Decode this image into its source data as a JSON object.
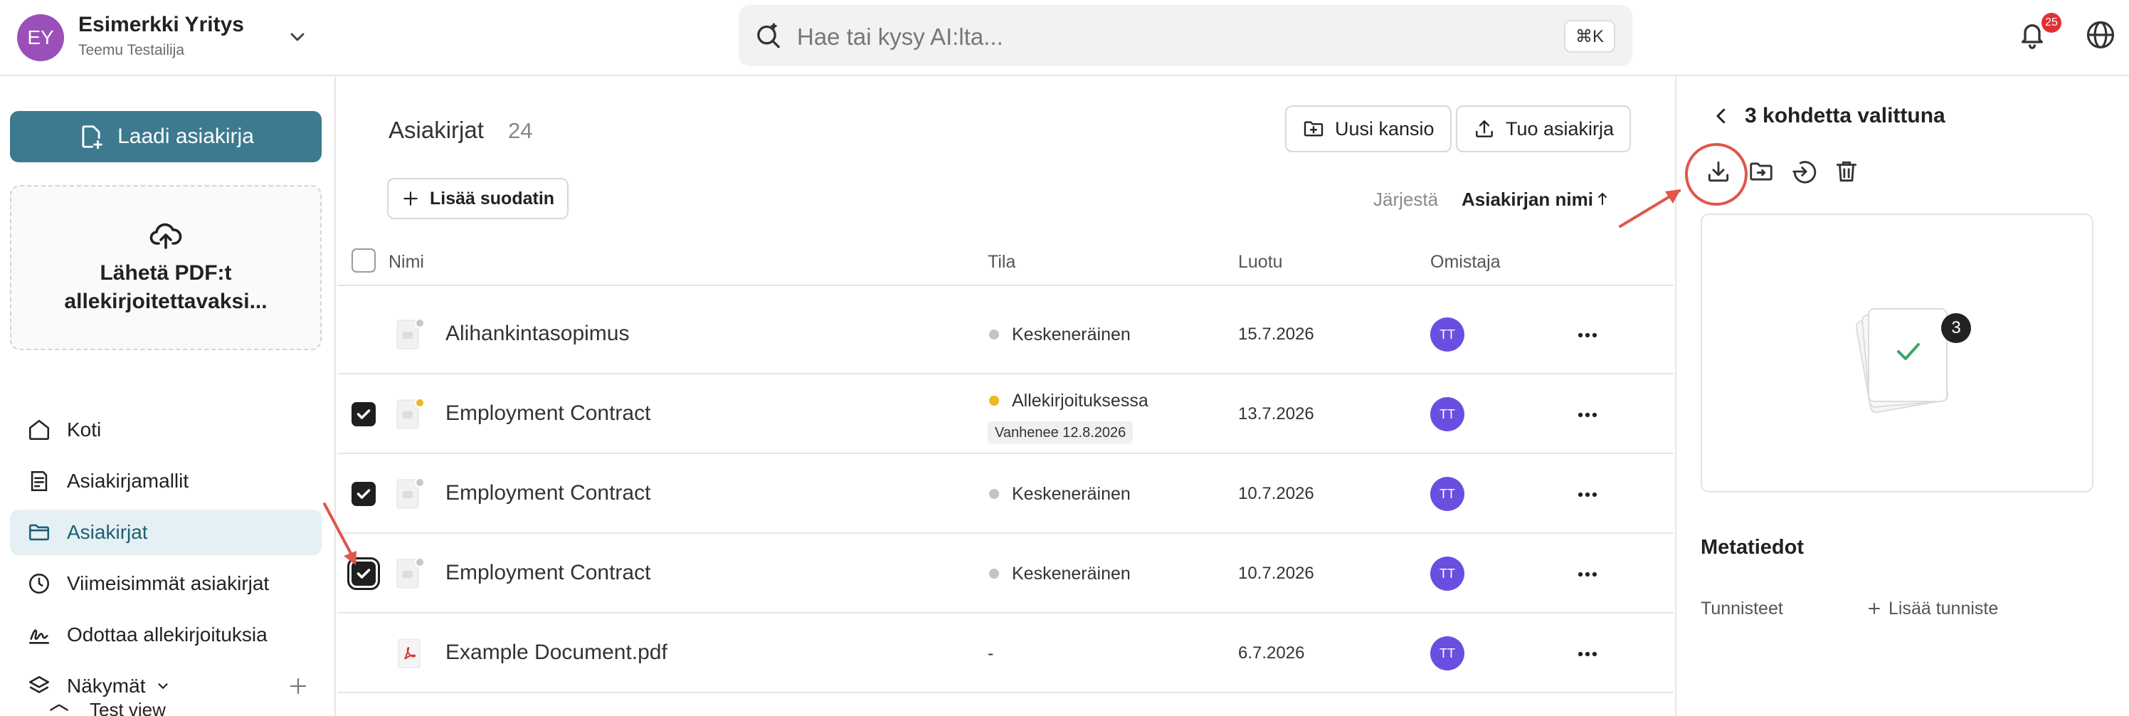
{
  "topbar": {
    "org_initials": "EY",
    "org_name": "Esimerkki Yritys",
    "user_name": "Teemu Testailija",
    "search_placeholder": "Hae tai kysy AI:lta...",
    "search_shortcut": "⌘K",
    "notification_count": "25"
  },
  "sidebar": {
    "create_button": "Laadi asiakirja",
    "upload_text": "Lähetä PDF:t allekirjoitettavaksi...",
    "items": [
      {
        "label": "Koti",
        "icon": "home-icon"
      },
      {
        "label": "Asiakirjamallit",
        "icon": "template-icon"
      },
      {
        "label": "Asiakirjat",
        "icon": "folder-icon",
        "active": true
      },
      {
        "label": "Viimeisimmät asiakirjat",
        "icon": "clock-icon"
      },
      {
        "label": "Odottaa allekirjoituksia",
        "icon": "signature-icon"
      },
      {
        "label": "Näkymät",
        "icon": "layers-icon"
      }
    ],
    "sub_item": "Test view"
  },
  "main": {
    "title": "Asiakirjat",
    "count": "24",
    "new_folder_button": "Uusi kansio",
    "import_button": "Tuo asiakirja",
    "add_filter_button": "Lisää suodatin",
    "sort_label": "Järjestä",
    "sort_value": "Asiakirjan nimi",
    "columns": [
      "Nimi",
      "Tila",
      "Luotu",
      "Omistaja"
    ],
    "rows": [
      {
        "name": "Alihankintasopimus",
        "status": "Keskeneräinen",
        "status_color": "#c4c4c4",
        "expiry": "",
        "created": "15.7.2026",
        "owner": "TT",
        "checked": false,
        "type": "doc"
      },
      {
        "name": "Employment Contract",
        "status": "Allekirjoituksessa",
        "status_color": "#e8b923",
        "expiry": "Vanhenee 12.8.2026",
        "created": "13.7.2026",
        "owner": "TT",
        "checked": true,
        "type": "doc"
      },
      {
        "name": "Employment Contract",
        "status": "Keskeneräinen",
        "status_color": "#c4c4c4",
        "expiry": "",
        "created": "10.7.2026",
        "owner": "TT",
        "checked": true,
        "type": "doc"
      },
      {
        "name": "Employment Contract",
        "status": "Keskeneräinen",
        "status_color": "#c4c4c4",
        "expiry": "",
        "created": "10.7.2026",
        "owner": "TT",
        "checked": true,
        "type": "doc"
      },
      {
        "name": "Example Document.pdf",
        "status": "-",
        "status_color": "",
        "expiry": "",
        "created": "6.7.2026",
        "owner": "TT",
        "checked": false,
        "type": "pdf"
      }
    ]
  },
  "panel": {
    "title": "3 kohdetta valittuna",
    "selected_count": "3",
    "metadata_title": "Metatiedot",
    "tags_label": "Tunnisteet",
    "add_tag": "Lisää tunniste",
    "tools": [
      "download-icon",
      "move-to-folder-icon",
      "export-icon",
      "trash-icon"
    ]
  },
  "colors": {
    "accent": "#3d7a8f",
    "annotation": "#e0564a",
    "owner_avatar": "#6a4ee0",
    "org_avatar": "#9b4fb8"
  }
}
